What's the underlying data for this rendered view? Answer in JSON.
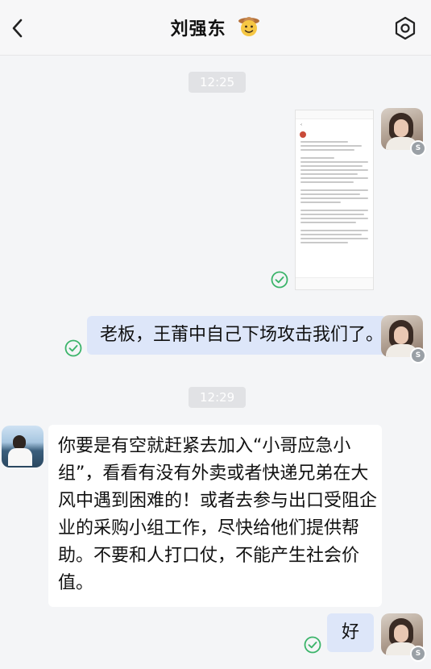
{
  "header": {
    "title": "刘强东",
    "title_emoji": "cowboy-face-emoji"
  },
  "timestamps": [
    "12:25",
    "12:29"
  ],
  "messages": [
    {
      "side": "right",
      "kind": "image",
      "content": "screenshot-of-article"
    },
    {
      "side": "right",
      "kind": "text",
      "text": "老板，王莆中自己下场攻击我们了。"
    },
    {
      "side": "left",
      "kind": "text",
      "lines": [
        "你要是有空就赶紧去加入“小哥应急小",
        "组”，看看有没有外卖或者快递兄弟在大",
        "风中遇到困难的！或者去参与出口受阻企",
        "业的采购小组工作，尽快给他们提供帮",
        "助。不要和人打口仗，不能产生社会价",
        "值。"
      ]
    },
    {
      "side": "right",
      "kind": "text",
      "text": "好"
    }
  ],
  "colors": {
    "bubble_right": "#dde6f9",
    "bubble_left": "#ffffff",
    "check_green": "#3bb46a",
    "background": "#f4f5f7"
  }
}
